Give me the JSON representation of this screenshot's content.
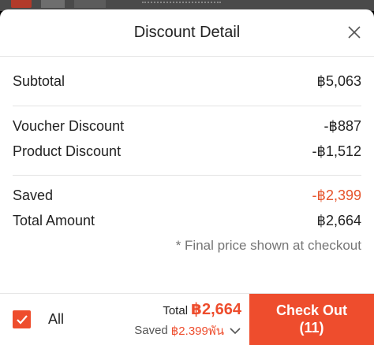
{
  "sheet": {
    "title": "Discount Detail"
  },
  "summary": {
    "subtotal_label": "Subtotal",
    "subtotal_value": "฿5,063",
    "voucher_label": "Voucher Discount",
    "voucher_value": "-฿887",
    "product_label": "Product Discount",
    "product_value": "-฿1,512",
    "saved_label": "Saved",
    "saved_value": "-฿2,399",
    "total_label": "Total Amount",
    "total_value": "฿2,664",
    "note": "* Final price shown at checkout"
  },
  "footer": {
    "all_label": "All",
    "all_checked": true,
    "total_label": "Total",
    "total_value": "฿2,664",
    "saved_label": "Saved",
    "saved_value": "฿2.399พัน",
    "checkout_label": "Check Out",
    "checkout_count": "(11)"
  },
  "colors": {
    "accent": "#ee4d2d",
    "saved_red": "#e6532b"
  },
  "icons": {
    "close": "close-icon",
    "check": "check-icon",
    "chevron": "chevron-down-icon"
  }
}
